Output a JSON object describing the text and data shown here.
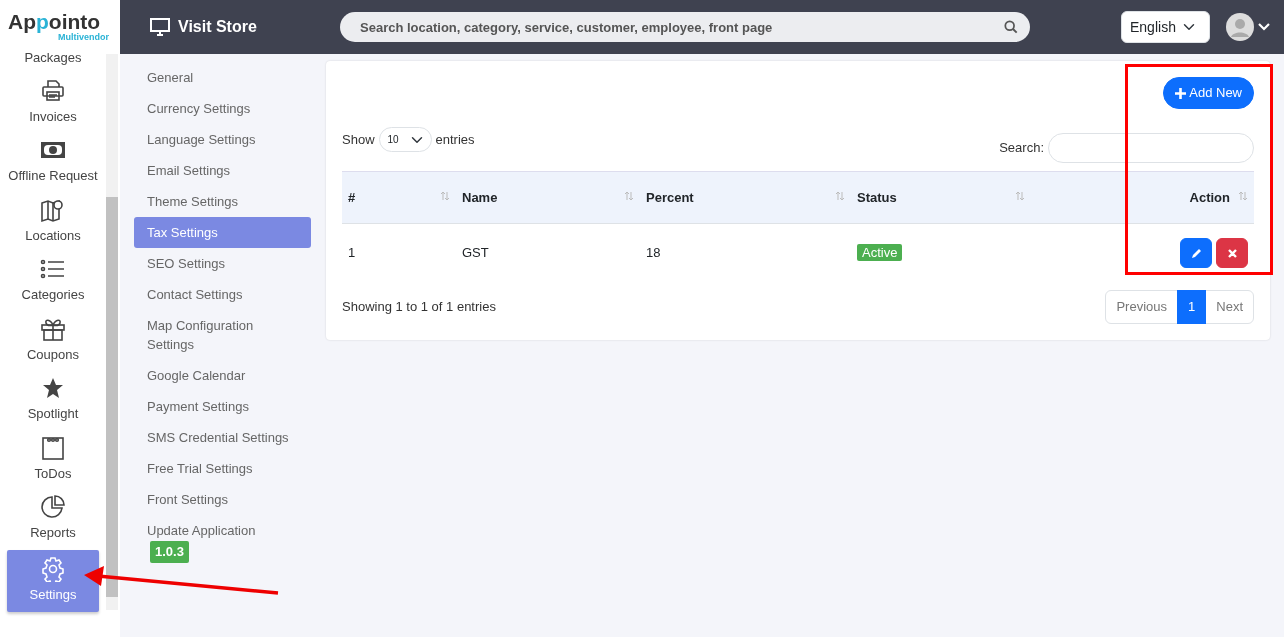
{
  "logo": {
    "name": "Appointo",
    "tagline": "Multivendor"
  },
  "topbar": {
    "visit_store": "Visit Store",
    "search": {
      "placeholder": "Search location, category, service, customer, employee, front page"
    },
    "language": "English"
  },
  "sidebar": {
    "items": [
      {
        "label": "Packages",
        "selected": false
      },
      {
        "label": "Invoices",
        "selected": false
      },
      {
        "label": "Offline Request",
        "selected": false
      },
      {
        "label": "Locations",
        "selected": false
      },
      {
        "label": "Categories",
        "selected": false
      },
      {
        "label": "Coupons",
        "selected": false
      },
      {
        "label": "Spotlight",
        "selected": false
      },
      {
        "label": "ToDos",
        "selected": false
      },
      {
        "label": "Reports",
        "selected": false
      },
      {
        "label": "Settings",
        "selected": true
      }
    ]
  },
  "settings_menu": [
    {
      "label": "General",
      "selected": false
    },
    {
      "label": "Currency Settings",
      "selected": false
    },
    {
      "label": "Language Settings",
      "selected": false
    },
    {
      "label": "Email Settings",
      "selected": false
    },
    {
      "label": "Theme Settings",
      "selected": false
    },
    {
      "label": "Tax Settings",
      "selected": true
    },
    {
      "label": "SEO Settings",
      "selected": false
    },
    {
      "label": "Contact Settings",
      "selected": false
    },
    {
      "label": "Map Configuration Settings",
      "selected": false
    },
    {
      "label": "Google Calendar",
      "selected": false
    },
    {
      "label": "Payment Settings",
      "selected": false
    },
    {
      "label": "SMS Credential Settings",
      "selected": false
    },
    {
      "label": "Free Trial Settings",
      "selected": false
    },
    {
      "label": "Front Settings",
      "selected": false
    },
    {
      "label": "Update Application",
      "selected": false,
      "badge": "1.0.3"
    }
  ],
  "table_card": {
    "add_button": "Add New",
    "show_label": "Show",
    "page_size": "10",
    "entries_label": "entries",
    "search_label": "Search:",
    "columns": [
      "#",
      "Name",
      "Percent",
      "Status",
      "Action"
    ],
    "rows": [
      {
        "number": "1",
        "name": "GST",
        "percent": "18",
        "status": "Active"
      }
    ],
    "info": "Showing 1 to 1 of 1 entries",
    "pagination": [
      {
        "label": "Previous",
        "selected": false
      },
      {
        "label": "1",
        "selected": true
      },
      {
        "label": "Next",
        "selected": false
      }
    ]
  }
}
